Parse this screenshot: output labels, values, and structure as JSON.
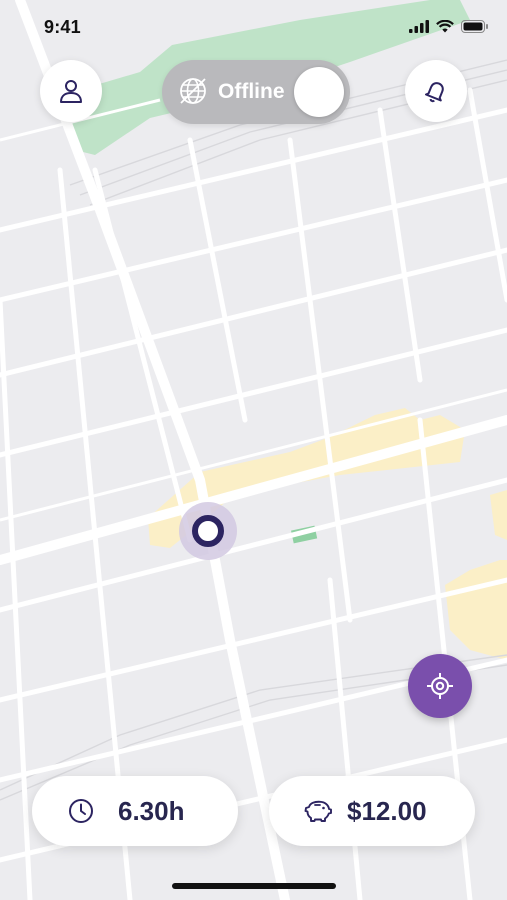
{
  "status_bar": {
    "time": "9:41"
  },
  "header": {
    "profile_icon": "person-icon",
    "notification_icon": "bell-icon",
    "status_toggle": {
      "label": "Offline",
      "icon": "globe-icon",
      "state": "off"
    }
  },
  "map": {
    "locate_icon": "crosshair-icon",
    "colors": {
      "park": "#bfe3c8",
      "commercial": "#fbefc7",
      "road": "#ffffff",
      "background": "#ececef"
    }
  },
  "stats": {
    "hours": {
      "icon": "clock-icon",
      "value": "6.30h"
    },
    "earnings": {
      "icon": "piggy-bank-icon",
      "value": "$12.00"
    }
  },
  "colors": {
    "accent": "#7a4fac",
    "marker": "#2c2461",
    "text_dark": "#28264f"
  }
}
